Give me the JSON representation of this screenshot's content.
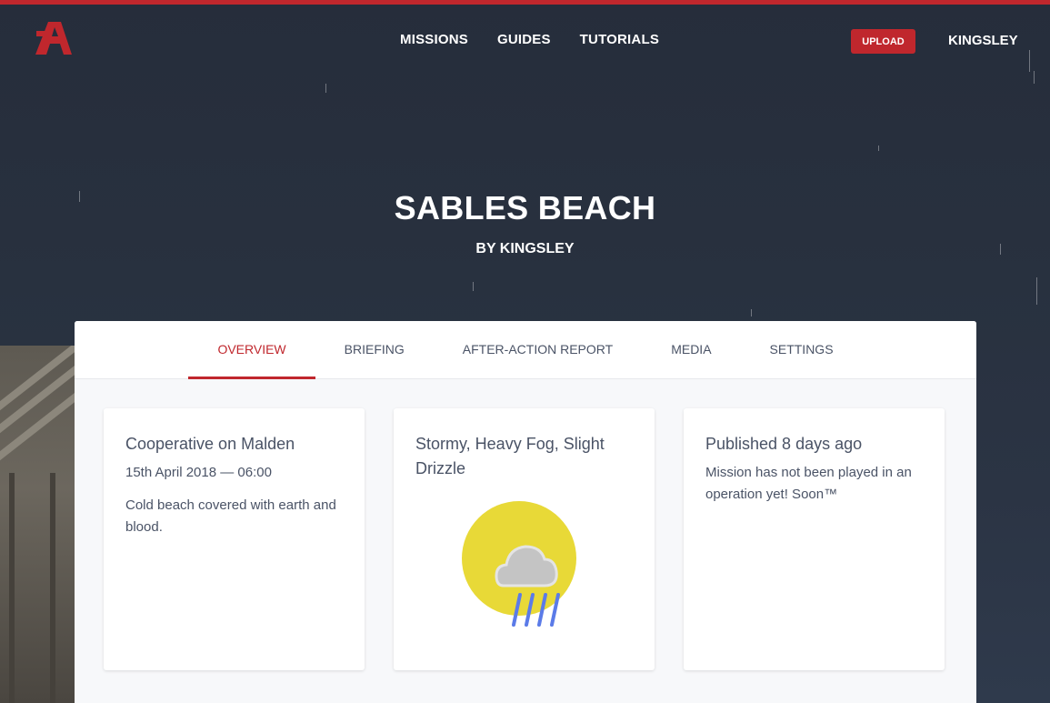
{
  "colors": {
    "accent": "#c0272d",
    "text": "#4a5366",
    "sun": "#e8d937",
    "cloud": "#c4c4c4",
    "rain": "#5b7be8"
  },
  "nav": {
    "logo": "arma-a-logo",
    "links": [
      "MISSIONS",
      "GUIDES",
      "TUTORIALS"
    ],
    "upload_label": "UPLOAD",
    "user": "KINGSLEY"
  },
  "hero": {
    "title": "SABLES BEACH",
    "byline": "BY KINGSLEY"
  },
  "tabs": [
    {
      "label": "OVERVIEW",
      "active": true
    },
    {
      "label": "BRIEFING",
      "active": false
    },
    {
      "label": "AFTER-ACTION REPORT",
      "active": false
    },
    {
      "label": "MEDIA",
      "active": false
    },
    {
      "label": "SETTINGS",
      "active": false
    }
  ],
  "cards": {
    "mission": {
      "title": "Cooperative on Malden",
      "datetime": "15th April 2018 — 06:00",
      "description": "Cold beach covered with earth and blood."
    },
    "weather": {
      "title": "Stormy, Heavy Fog, Slight Drizzle",
      "icon": "sun-cloud-rain-icon"
    },
    "published": {
      "title": "Published 8 days ago",
      "text": "Mission has not been played in an operation yet! Soon™"
    }
  }
}
